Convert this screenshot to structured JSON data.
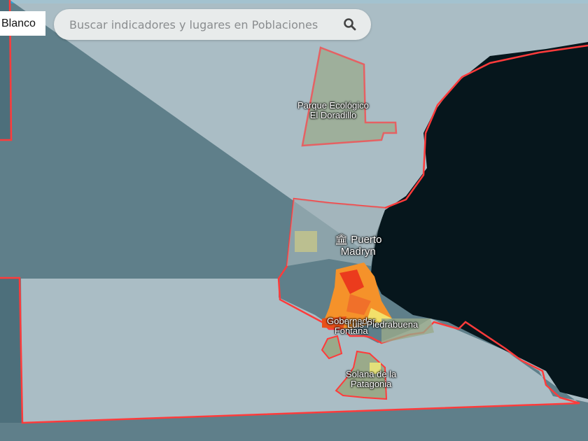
{
  "basemap_button": {
    "label": "Blanco"
  },
  "search": {
    "placeholder": "Buscar indicadores y lugares en Poblaciones",
    "value": ""
  },
  "map_labels": {
    "parque": "Parque Ecológico\nEl Doradillo",
    "parque_line1": "Parque Ecológico",
    "parque_line2": "El Doradillo",
    "puerto_line1": "Puerto",
    "puerto_line2": "Madryn",
    "gobernador_line1": "Gobernador",
    "gobernador_line2": "Fontana",
    "luis": "Luis Piedrabuena",
    "solana_line1": "Solana de la",
    "solana_line2": "Patagonia"
  },
  "colors": {
    "boundary": "#ff3b3b",
    "sea": "#06161c",
    "land": "#a9bcc4",
    "choropleth_high": "#e8261a",
    "choropleth_mid": "#f5922a",
    "choropleth_low": "#f3e06a"
  }
}
